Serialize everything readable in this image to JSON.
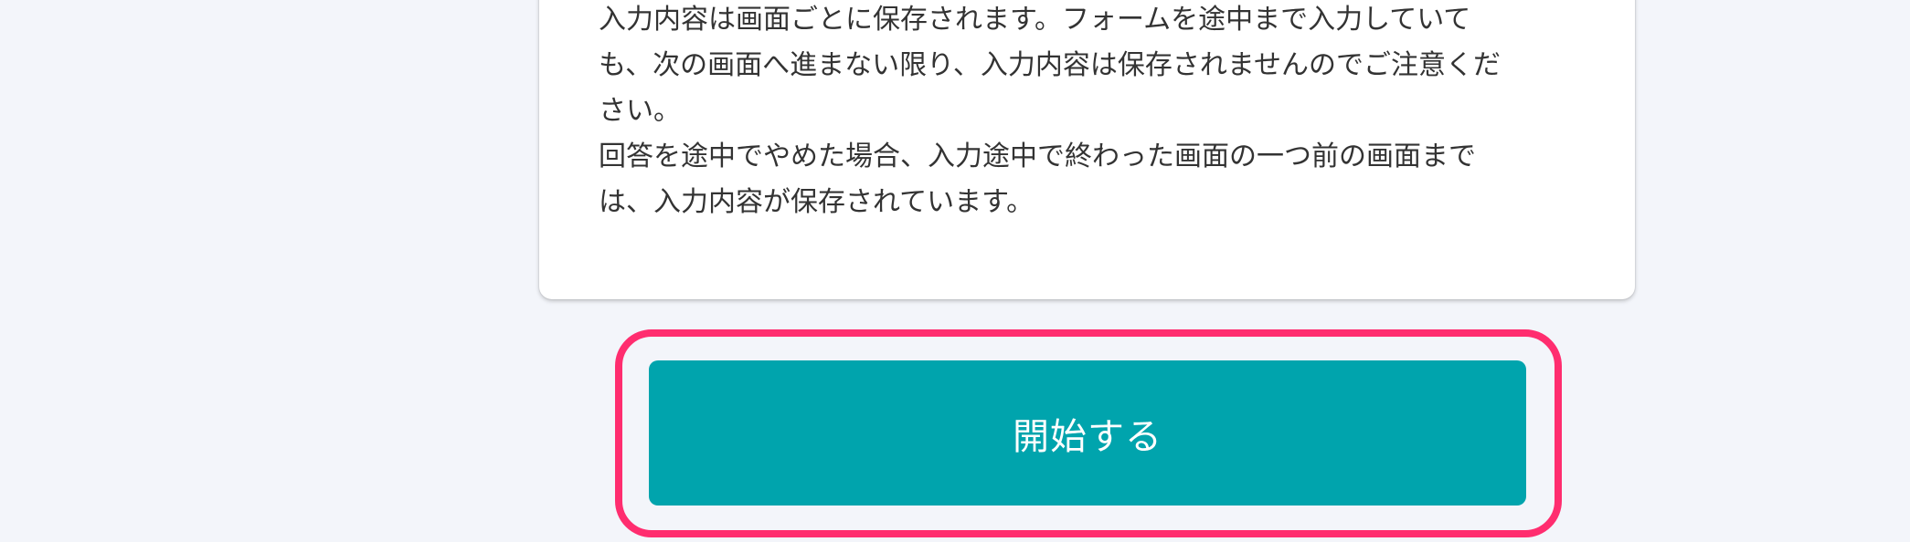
{
  "notice": {
    "lines": [
      "入力内容は画面ごとに保存されます。フォームを途中まで入力していて",
      "も、次の画面へ進まない限り、入力内容は保存されませんのでご注意くだ",
      "さい。",
      "回答を途中でやめた場合、入力途中で終わった画面の一つ前の画面まで",
      "は、入力内容が保存されています。"
    ]
  },
  "start_button": {
    "label": "開始する"
  },
  "colors": {
    "page_background": "#f3f5fa",
    "card_background": "#ffffff",
    "button_background": "#00a4ad",
    "button_text": "#ffffff",
    "highlight_outline": "#ff2d6f",
    "body_text": "#333333"
  }
}
